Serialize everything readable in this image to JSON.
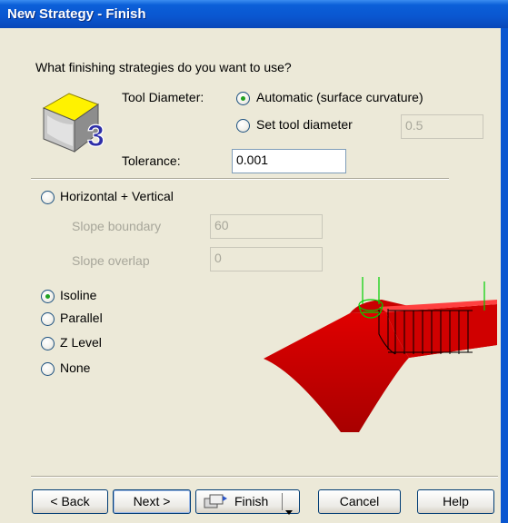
{
  "window": {
    "title": "New Strategy - Finish"
  },
  "prompt": "What finishing strategies do you want to use?",
  "tool_diameter": {
    "label": "Tool Diameter:",
    "options": [
      {
        "label": "Automatic (surface curvature)",
        "selected": true
      },
      {
        "label": "Set tool diameter",
        "selected": false
      }
    ],
    "value": "0.5"
  },
  "tolerance": {
    "label": "Tolerance:",
    "value": "0.001"
  },
  "strategies": {
    "horizontal_vertical": {
      "label": "Horizontal + Vertical",
      "selected": false
    },
    "slope_boundary": {
      "label": "Slope boundary",
      "value": "60"
    },
    "slope_overlap": {
      "label": "Slope overlap",
      "value": "0"
    },
    "options": [
      {
        "label": "Isoline",
        "selected": true
      },
      {
        "label": "Parallel",
        "selected": false
      },
      {
        "label": "Z Level",
        "selected": false
      },
      {
        "label": "None",
        "selected": false
      }
    ]
  },
  "buttons": {
    "back": "< Back",
    "next": "Next >",
    "finish": "Finish",
    "cancel": "Cancel",
    "help": "Help"
  },
  "icons": {
    "logo": "3-axis-finish-icon",
    "preview": "isoline-toolpath-preview"
  },
  "colors": {
    "accent": "#21a121",
    "titlebar": "#0a56d0",
    "surface": "#d60000",
    "toolpath": "#00d000"
  }
}
